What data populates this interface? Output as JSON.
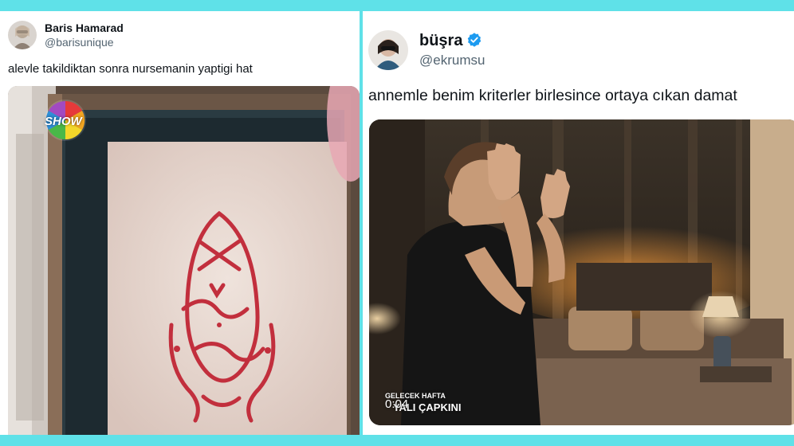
{
  "tweet_left": {
    "display_name": "Baris Hamarad",
    "handle": "@barisunique",
    "text": "alevle takildiktan sonra nursemanin yaptigi hat",
    "media": {
      "kind": "photo",
      "channel_logo_text": "SHOW",
      "subject": "red calligraphy in a framed panel"
    }
  },
  "tweet_right": {
    "display_name": "büşra",
    "verified": true,
    "handle": "@ekrumsu",
    "text": "annemle benim kriterler birlesince ortaya cıkan damat",
    "media": {
      "kind": "video",
      "caption_top": "GELECEK HAFTA",
      "caption_bottom": "YALI ÇAPKINI",
      "timestamp": "0:04"
    }
  },
  "colors": {
    "frame_background": "#5fe1e8",
    "card_background": "#ffffff",
    "name_text": "#0f1419",
    "handle_text": "#536471",
    "verified_badge": "#1d9bf0"
  },
  "icons": {
    "verified": "verified-badge-icon"
  }
}
